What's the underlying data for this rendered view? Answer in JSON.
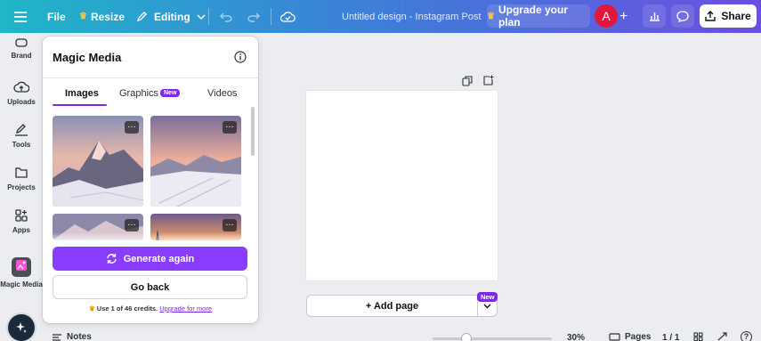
{
  "topbar": {
    "file_label": "File",
    "resize_label": "Resize",
    "editing_label": "Editing",
    "design_title": "Untitled design - Instagram Post",
    "upgrade_label": "Upgrade your plan",
    "avatar_letter": "A",
    "share_label": "Share"
  },
  "rail": {
    "items": [
      {
        "label": "Brand"
      },
      {
        "label": "Uploads"
      },
      {
        "label": "Tools"
      },
      {
        "label": "Projects"
      },
      {
        "label": "Apps"
      },
      {
        "label": "Magic Media"
      }
    ]
  },
  "panel": {
    "title": "Magic Media",
    "tabs": [
      {
        "label": "Images"
      },
      {
        "label": "Graphics"
      },
      {
        "label": "Videos"
      }
    ],
    "graphics_badge": "New",
    "more_glyph": "…",
    "generate_again_label": "Generate again",
    "go_back_label": "Go back",
    "credits_text": "Use 1 of 46 credits.",
    "credits_link": "Upgrade for more"
  },
  "canvas": {
    "add_page_label": "+ Add page",
    "new_badge": "New"
  },
  "bottombar": {
    "notes_label": "Notes",
    "zoom_value": "30%",
    "pages_label": "Pages",
    "page_count": "1 / 1",
    "help_label": "?"
  },
  "colors": {
    "accent": "#8b3dff",
    "accent_text": "#7d2ae8",
    "avatar": "#e3163b"
  }
}
